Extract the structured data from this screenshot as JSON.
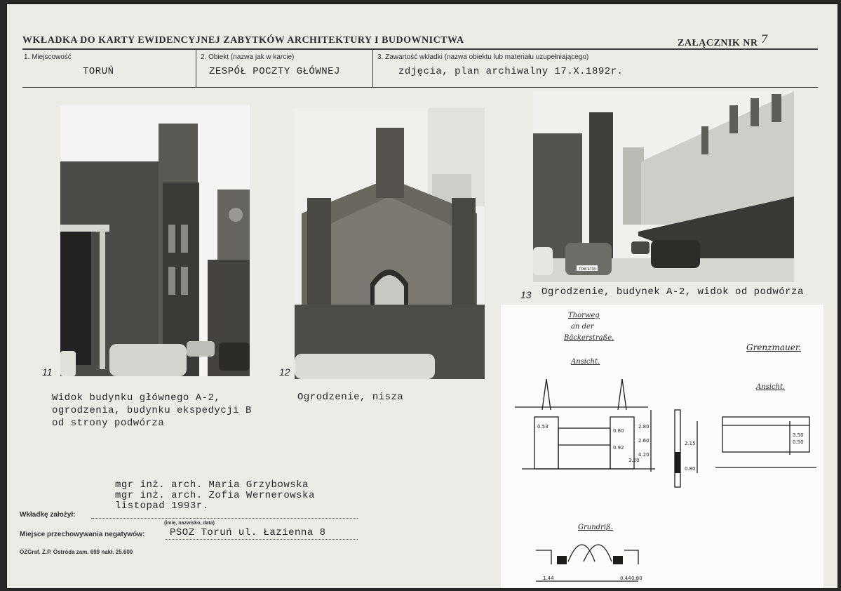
{
  "header": {
    "title": "WKŁADKA DO KARTY EWIDENCYJNEJ ZABYTKÓW ARCHITEKTURY I BUDOWNICTWA",
    "attachment_label": "ZAŁĄCZNIK NR",
    "attachment_number": "7"
  },
  "fields": {
    "f1_label": "1. Miejscowość",
    "f1_value": "TORUŃ",
    "f2_label": "2. Obiekt (nazwa jak w karcie)",
    "f2_value": "ZESPÓŁ POCZTY GŁÓWNEJ",
    "f3_label": "3. Zawartość wkładki (nazwa obiektu lub materiału uzupełniającego)",
    "f3_value": "zdjęcia, plan archiwalny 17.X.1892r."
  },
  "photos": [
    {
      "number": "11",
      "caption": "Widok budynku głównego A-2,\nogrodzenia, budynku ekspedycji B\nod strony podwórza"
    },
    {
      "number": "12",
      "caption": "Ogrodzenie, nisza"
    },
    {
      "number": "13",
      "caption": "Ogrodzenie, budynek A-2, widok od podwórza"
    }
  ],
  "plate_text": "TOW 4718",
  "drawing": {
    "title_line1": "Thorweg",
    "title_line2": "an der",
    "title_line3": "Bäckerstraße.",
    "left_view": "Ansicht.",
    "right_title": "Grenzmauer.",
    "right_view": "Ansicht.",
    "plan": "Grundriß.",
    "dims": [
      "0.53",
      "2.80",
      "0.80",
      "2.60",
      "0.92",
      "4.20",
      "3.20",
      "2.15",
      "0.80",
      "1.44",
      "0.44",
      "0.80",
      "0.50",
      "3.50"
    ]
  },
  "footer": {
    "authors": "mgr inż. arch. Maria Grzybowska\nmgr inż. arch. Zofia Wernerowska\nlistopad 1993r.",
    "made_by_label": "Wkładkę założył:",
    "made_by_sub": "(imię, nazwisko, data)",
    "storage_label": "Miejsce przechowywania negatywów:",
    "storage_value": "PSOZ Toruń ul. Łazienna 8",
    "printer": "OZGraf. Z.P. Ostróda zam. 699 nakł. 25.600"
  }
}
